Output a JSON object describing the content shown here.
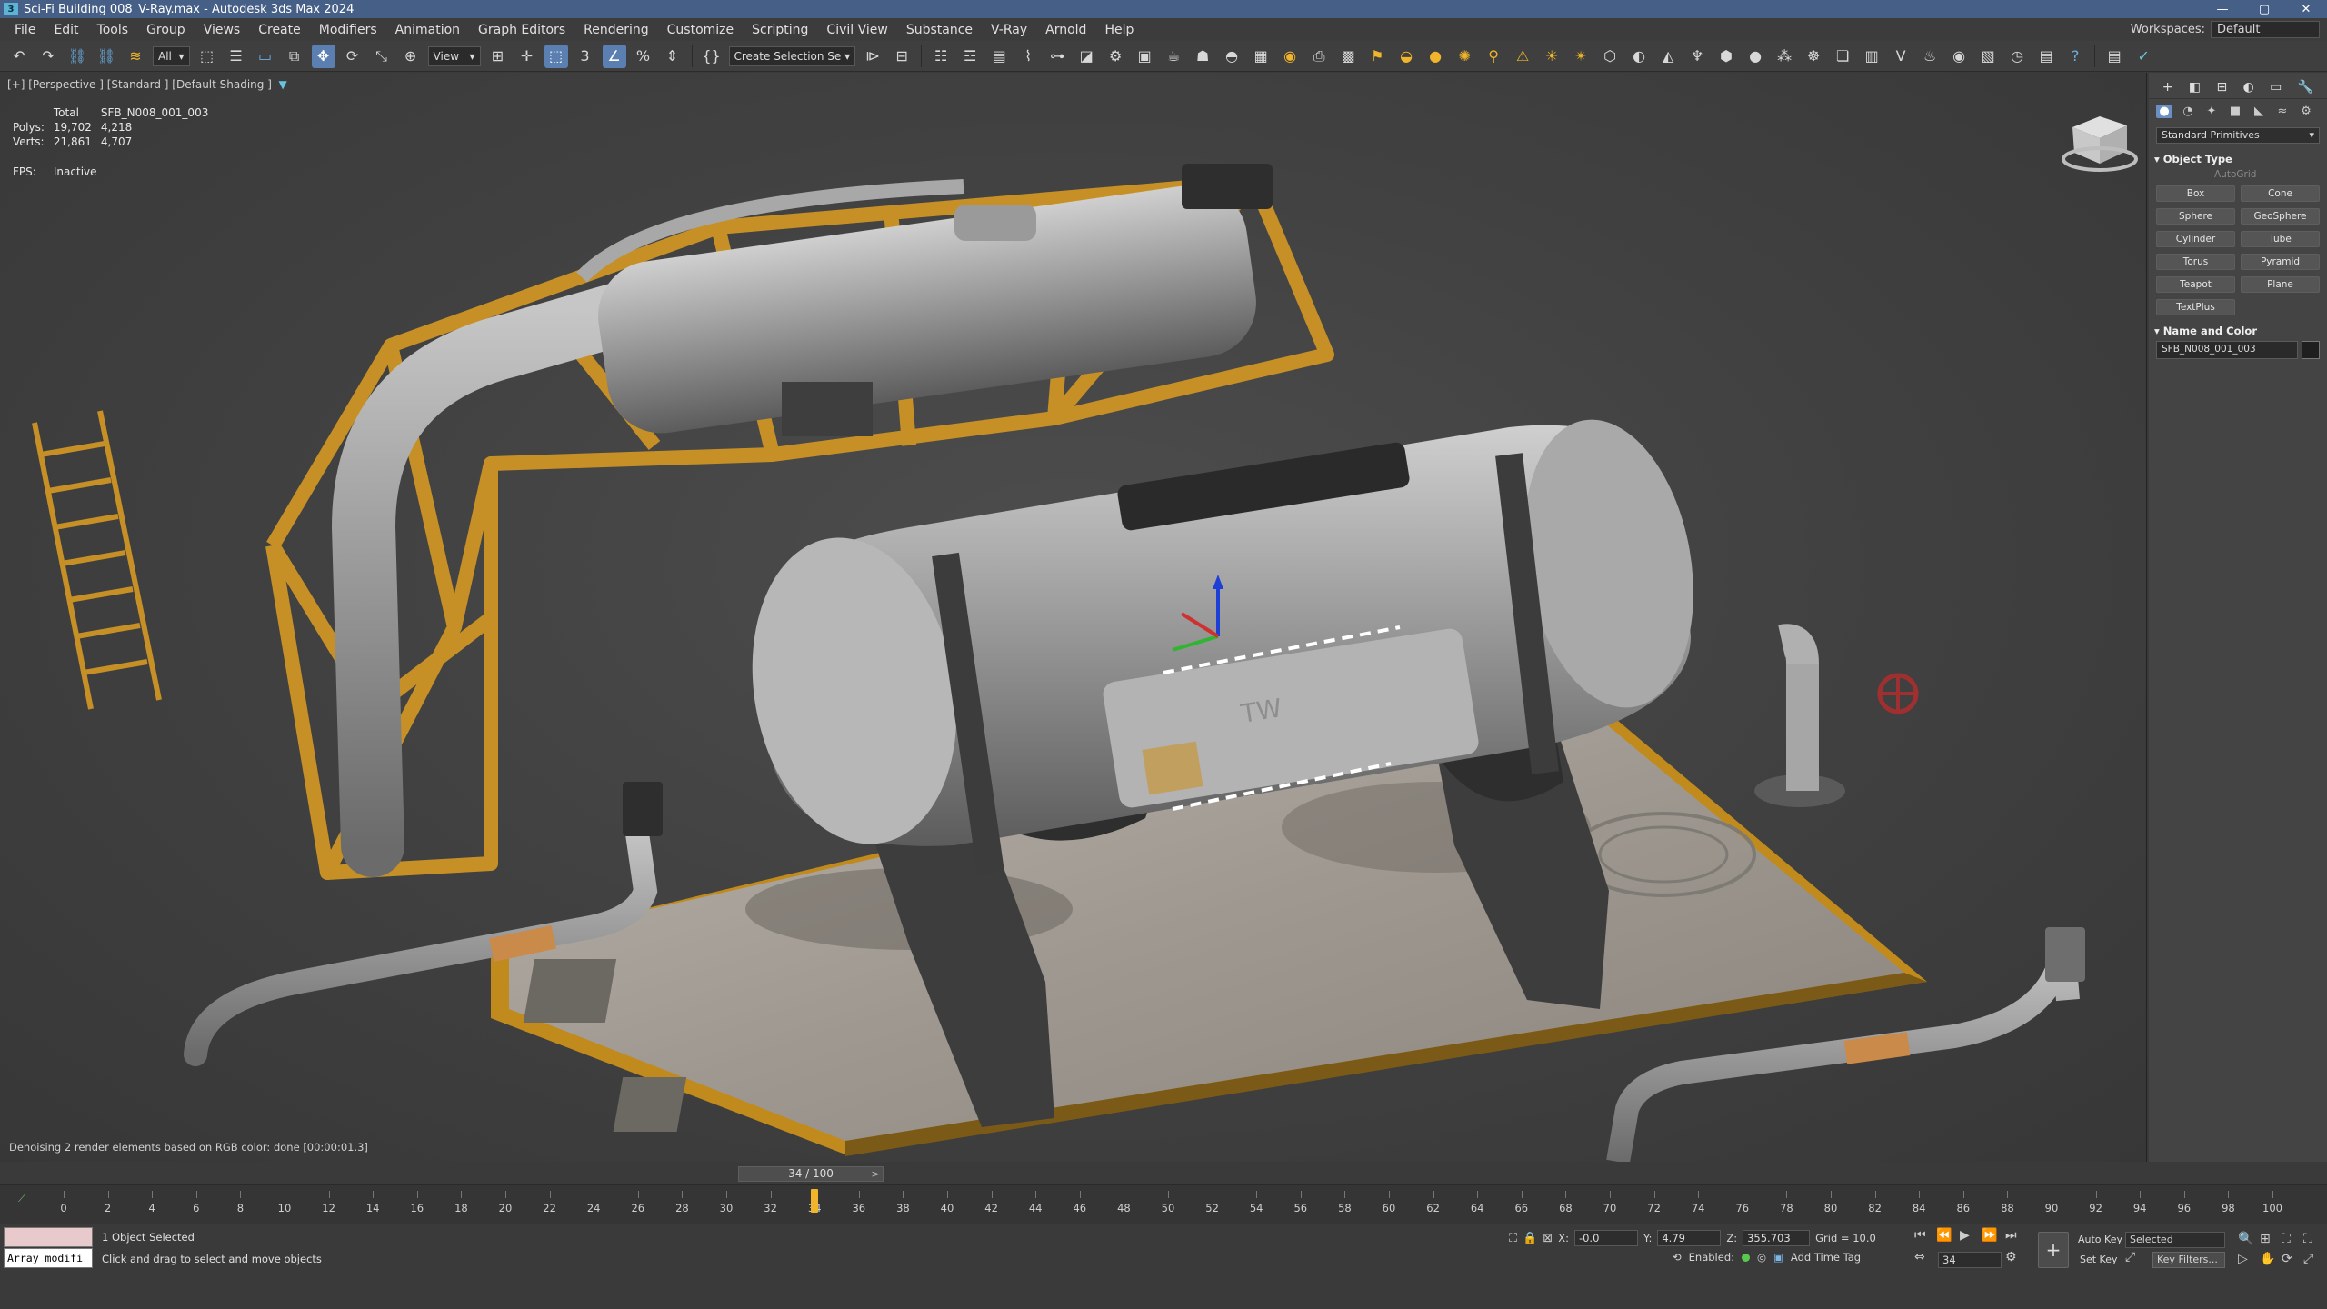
{
  "window": {
    "title": "Sci-Fi Building 008_V-Ray.max - Autodesk 3ds Max 2024",
    "logo": "3",
    "controls": [
      "—",
      "▢",
      "✕"
    ]
  },
  "menu": {
    "items": [
      "File",
      "Edit",
      "Tools",
      "Group",
      "Views",
      "Create",
      "Modifiers",
      "Animation",
      "Graph Editors",
      "Rendering",
      "Customize",
      "Scripting",
      "Civil View",
      "Substance",
      "V-Ray",
      "Arnold",
      "Help"
    ],
    "workspace_label": "Workspaces:",
    "workspace_value": "Default"
  },
  "toolbar": {
    "selection_filter": "All",
    "ref_coord": "View",
    "named_selection": "Create Selection Se"
  },
  "viewport": {
    "label": "[+] [Perspective ] [Standard ] [Default Shading ]",
    "stats": {
      "header_left": "Total",
      "header_right": "SFB_N008_001_003",
      "rows": [
        {
          "label": "Polys:",
          "total": "19,702",
          "selected": "4,218"
        },
        {
          "label": "Verts:",
          "total": "21,861",
          "selected": "4,707"
        }
      ]
    },
    "fps_label": "FPS:",
    "fps_value": "Inactive",
    "denoise_msg": "Denoising 2 render elements based on RGB color: done [00:00:01.3]",
    "scene_text": "TW"
  },
  "command_panel": {
    "category": "Standard Primitives",
    "object_type_title": "Object Type",
    "autogrid": "AutoGrid",
    "buttons": [
      "Box",
      "Cone",
      "Sphere",
      "GeoSphere",
      "Cylinder",
      "Tube",
      "Torus",
      "Pyramid",
      "Teapot",
      "Plane",
      "TextPlus"
    ],
    "name_color_title": "Name and Color",
    "object_name": "SFB_N008_001_003"
  },
  "time_slider": {
    "value": "34 / 100",
    "current_frame": 34,
    "total_frames": 100
  },
  "trackbar": {
    "ticks": [
      0,
      2,
      4,
      6,
      8,
      10,
      12,
      14,
      16,
      18,
      20,
      22,
      24,
      26,
      28,
      30,
      32,
      34,
      36,
      38,
      40,
      42,
      44,
      46,
      48,
      50,
      52,
      54,
      56,
      58,
      60,
      62,
      64,
      66,
      68,
      70,
      72,
      74,
      76,
      78,
      80,
      82,
      84,
      86,
      88,
      90,
      92,
      94,
      96,
      98,
      100
    ]
  },
  "status": {
    "maxscript_text": "Array modifi",
    "selection": "1 Object Selected",
    "prompt": "Click and drag to select and move objects",
    "x_label": "X:",
    "x_value": "-0.0",
    "y_label": "Y:",
    "y_value": "4.79",
    "z_label": "Z:",
    "z_value": "355.703",
    "grid": "Grid = 10.0",
    "enabled_label": "Enabled:",
    "add_time_tag": "Add Time Tag",
    "auto_key": "Auto Key",
    "set_key": "Set Key",
    "key_mode": "Selected",
    "key_filters": "Key Filters...",
    "frame": "34"
  }
}
